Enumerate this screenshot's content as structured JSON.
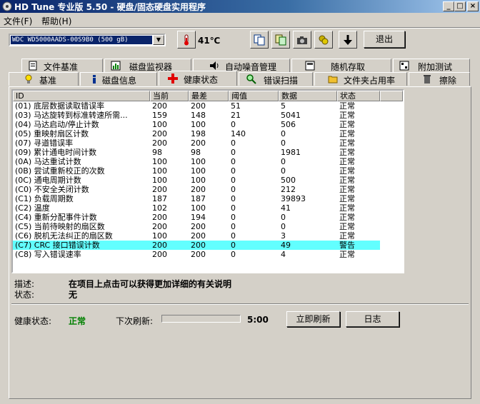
{
  "window": {
    "title": "HD Tune 专业版 5.50 - 硬盘/固态硬盘实用程序",
    "controls": [
      "_",
      "□",
      "×"
    ]
  },
  "menu": {
    "file": "文件(F)",
    "help": "帮助(H)"
  },
  "toolbar": {
    "drive": "WDC WD5000AADS-00S9B0 (500 gB)",
    "temperature": "41℃",
    "exit_label": "退出"
  },
  "tabs_row1": [
    "文件基准",
    "磁盘监视器",
    "自动噪音管理",
    "随机存取",
    "附加测试"
  ],
  "tabs_row2": [
    "基准",
    "磁盘信息",
    "健康状态",
    "错误扫描",
    "文件夹占用率",
    "擦除"
  ],
  "active_tab": "健康状态",
  "table": {
    "headers": [
      "ID",
      "当前",
      "最差",
      "阈值",
      "数据",
      "状态"
    ],
    "rows": [
      [
        "(01) 底层数据读取错误率",
        "200",
        "200",
        "51",
        "5",
        "正常"
      ],
      [
        "(03) 马达旋转到标准转速所需...",
        "159",
        "148",
        "21",
        "5041",
        "正常"
      ],
      [
        "(04) 马达启动/停止计数",
        "100",
        "100",
        "0",
        "506",
        "正常"
      ],
      [
        "(05) 重映射扇区计数",
        "200",
        "198",
        "140",
        "0",
        "正常"
      ],
      [
        "(07) 寻道错误率",
        "200",
        "200",
        "0",
        "0",
        "正常"
      ],
      [
        "(09) 累计通电时间计数",
        "98",
        "98",
        "0",
        "1981",
        "正常"
      ],
      [
        "(0A) 马达重试计数",
        "100",
        "100",
        "0",
        "0",
        "正常"
      ],
      [
        "(0B) 尝试重新校正的次数",
        "100",
        "100",
        "0",
        "0",
        "正常"
      ],
      [
        "(0C) 通电周期计数",
        "100",
        "100",
        "0",
        "500",
        "正常"
      ],
      [
        "(C0) 不安全关闭计数",
        "200",
        "200",
        "0",
        "212",
        "正常"
      ],
      [
        "(C1) 负载周期数",
        "187",
        "187",
        "0",
        "39893",
        "正常"
      ],
      [
        "(C2) 温度",
        "102",
        "100",
        "0",
        "41",
        "正常"
      ],
      [
        "(C4) 重新分配事件计数",
        "200",
        "194",
        "0",
        "0",
        "正常"
      ],
      [
        "(C5) 当前待映射的扇区数",
        "200",
        "200",
        "0",
        "0",
        "正常"
      ],
      [
        "(C6) 脱机无法纠正的扇区数",
        "100",
        "200",
        "0",
        "3",
        "正常"
      ],
      [
        "(C7) CRC 接口错误计数",
        "200",
        "200",
        "0",
        "49",
        "警告"
      ],
      [
        "(C8) 写入错误速率",
        "200",
        "200",
        "0",
        "4",
        "正常"
      ]
    ],
    "selected_row": 15
  },
  "details": {
    "desc_label": "描述:",
    "desc_value": "在项目上点击可以获得更加详细的有关说明",
    "status_label": "状态:",
    "status_value": "无"
  },
  "footer": {
    "health_label": "健康状态:",
    "health_value": "正常",
    "refresh_label": "下次刷新:",
    "countdown": "5:00",
    "refresh_now": "立即刷新",
    "log": "日志"
  },
  "colors": {
    "title_start": "#0a246a",
    "ok": "#008000",
    "selection": "#62ffff"
  }
}
